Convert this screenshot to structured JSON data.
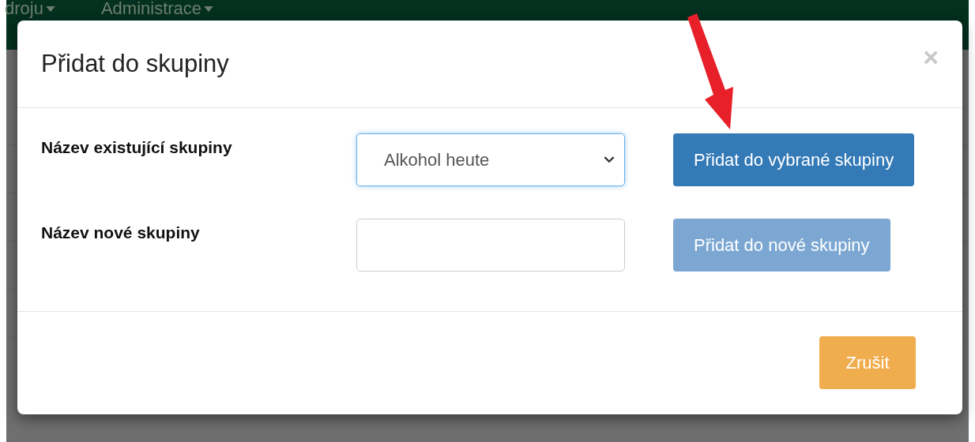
{
  "navbar": {
    "items": [
      {
        "label": "droju"
      },
      {
        "label": "Administrace"
      }
    ]
  },
  "modal": {
    "title": "Přidat do skupiny",
    "close": "×",
    "rows": [
      {
        "label": "Název existující skupiny",
        "kind": "select",
        "value": "Alkohol heute",
        "focused": true,
        "button": {
          "label": "Přidat do vybrané skupiny",
          "disabled": false
        }
      },
      {
        "label": "Název nové skupiny",
        "kind": "input",
        "value": "",
        "focused": false,
        "button": {
          "label": "Přidat do nové skupiny",
          "disabled": true
        }
      }
    ],
    "footer_button": "Zrušit"
  }
}
